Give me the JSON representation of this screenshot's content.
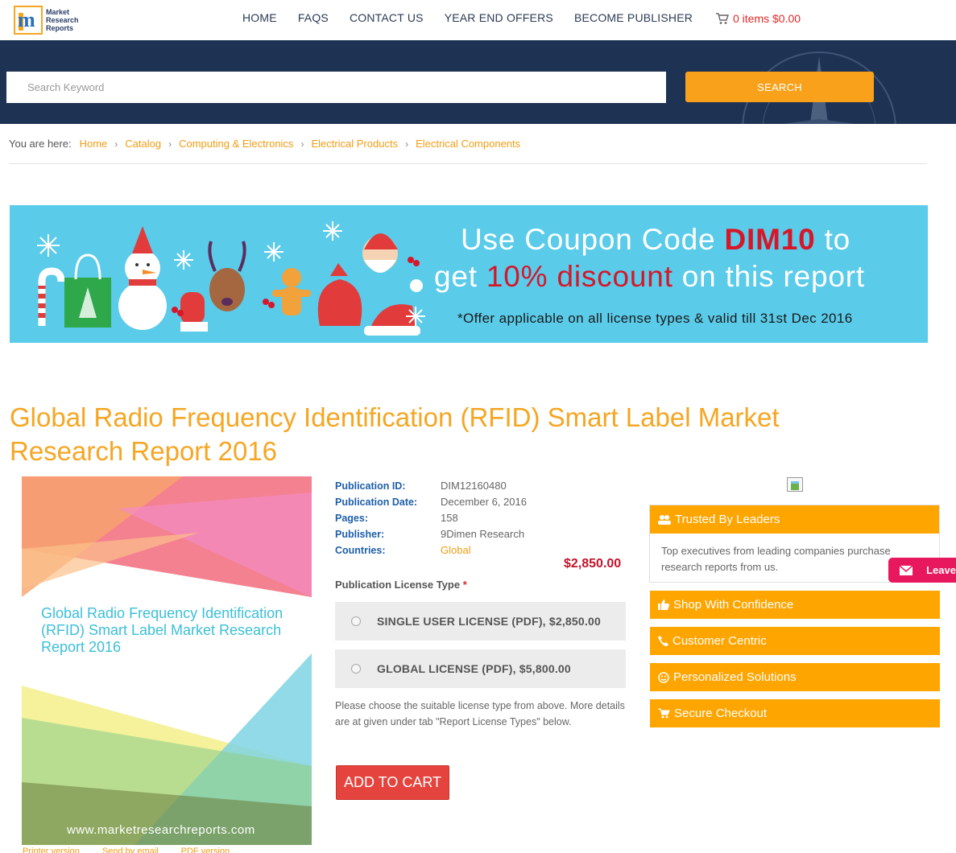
{
  "header": {
    "logo_text": [
      "Market",
      "Research",
      "Reports"
    ],
    "nav": [
      "HOME",
      "FAQS",
      "CONTACT US",
      "YEAR END OFFERS",
      "BECOME PUBLISHER"
    ],
    "cart_text": "0 items $0.00"
  },
  "search": {
    "placeholder": "Search Keyword",
    "button_label": "SEARCH"
  },
  "breadcrumb": {
    "prefix": "You are here:",
    "items": [
      "Home",
      "Catalog",
      "Computing & Electronics",
      "Electrical Products",
      "Electrical Components"
    ]
  },
  "banner": {
    "line1_a": "Use Coupon Code ",
    "line1_code": "DIM10",
    "line1_b": " to",
    "line2_a": "get ",
    "line2_red": "10% discount",
    "line2_b": " on this report",
    "line3": "*Offer applicable on all license types & valid till 31st Dec 2016"
  },
  "report": {
    "title": "Global Radio Frequency Identification (RFID) Smart Label Market Research Report 2016",
    "cover_title": "Global Radio Frequency Identification (RFID) Smart Label Market Research Report 2016",
    "cover_url": "www.marketresearchreports.com",
    "below_cover": [
      "Printer version",
      "Send by email",
      "PDF version"
    ],
    "details": [
      {
        "label": "Publication ID:",
        "value": "DIM12160480"
      },
      {
        "label": "Publication Date:",
        "value": "December 6, 2016"
      },
      {
        "label": "Pages:",
        "value": "158"
      },
      {
        "label": "Publisher:",
        "value": "9Dimen Research"
      },
      {
        "label": "Countries:",
        "value": "Global"
      }
    ],
    "price": "$2,850.00",
    "license_label": "Publication License Type",
    "license_required": "*",
    "licenses": [
      "SINGLE USER LICENSE (PDF), $2,850.00",
      "GLOBAL LICENSE (PDF), $5,800.00"
    ],
    "note": "Please choose the suitable license type from above. More details are at given under tab \"Report License Types\" below.",
    "add_to_cart": "ADD TO CART"
  },
  "sidebar": {
    "trusted_title": "Trusted By Leaders",
    "trusted_body": "Top executives from leading companies purchase research reports from us.",
    "features": [
      "Shop With Confidence",
      "Customer Centric",
      "Personalized Solutions",
      "Secure Checkout"
    ],
    "feature_icons": [
      "thumbs-up-icon",
      "phone-icon",
      "smile-icon",
      "cart-icon"
    ],
    "leave_label": "Leave"
  },
  "colors": {
    "accent_orange": "#ffa500",
    "search_band": "#1e3254",
    "banner_blue": "#5acbe9",
    "price_red": "#c4122a",
    "cart_button": "#e5433d"
  }
}
